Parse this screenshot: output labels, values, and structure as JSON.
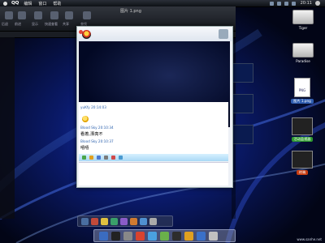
{
  "menubar": {
    "app_name": "QQ",
    "menus": [
      "编辑",
      "窗口",
      "帮助"
    ],
    "time": "20:11"
  },
  "background_window": {
    "title": "图片 1.png",
    "toolbar_labels": [
      "后退",
      "前进",
      "显示",
      "快速查看",
      "共享",
      "查找"
    ]
  },
  "chat_window": {
    "messages": [
      {
        "sender": "yuKfy",
        "time": "20:14:03",
        "type": "emote"
      },
      {
        "sender": "Blood Sky",
        "time": "20:10:34",
        "text": "看着,漂亮不"
      },
      {
        "sender": "Blood Sky",
        "time": "20:10:37",
        "text": "嘻嘻"
      }
    ]
  },
  "desktop_icons": [
    {
      "name": "drive-tiger",
      "label": "Tiger",
      "kind": "drive"
    },
    {
      "name": "drive-paradise",
      "label": "Paradise",
      "kind": "drive"
    },
    {
      "name": "file-image",
      "label": "图片 1.png",
      "kind": "document",
      "badge": "PNG"
    },
    {
      "name": "activity-monitor",
      "label": "活动监视器",
      "kind": "terminal",
      "label_color": "#2f9a2f"
    },
    {
      "name": "terminal",
      "label": "终端",
      "kind": "terminal",
      "label_color": "#c83c10"
    }
  ],
  "watermark": "www.sanhe.net",
  "colors": {
    "menubar": "#15181d",
    "qq_chat_meta": "#2e62ae",
    "selected_label": "#2f5db0"
  }
}
